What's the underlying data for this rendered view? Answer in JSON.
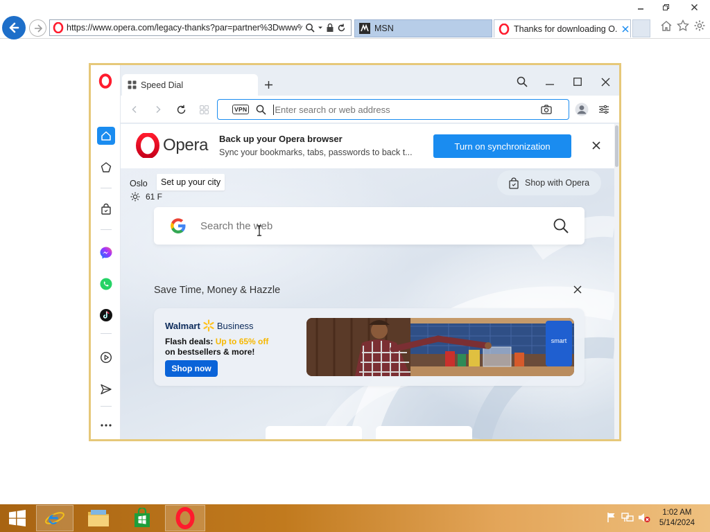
{
  "ie": {
    "url": "https://www.opera.com/legacy-thanks?par=partner%3Dwww%2",
    "tabs": [
      {
        "label": "MSN",
        "active": false
      },
      {
        "label": "Thanks for downloading O...",
        "active": true
      }
    ]
  },
  "opera": {
    "tab": {
      "label": "Speed Dial"
    },
    "address": {
      "vpn_label": "VPN",
      "placeholder": "Enter search or web address"
    },
    "sync": {
      "logo_text": "Opera",
      "title": "Back up your Opera browser",
      "desc": "Sync your bookmarks, tabs, passwords to back t...",
      "button": "Turn on synchronization"
    },
    "weather": {
      "city": "Oslo",
      "tooltip": "Set up your city",
      "temp": "61 F"
    },
    "shop": {
      "label": "Shop with Opera"
    },
    "search": {
      "placeholder": "Search the web"
    },
    "promo": {
      "section_title": "Save Time, Money & Hazzle",
      "brand": "Walmart",
      "brand_suffix": "Business",
      "deal_line1": "Flash deals: ",
      "deal_highlight": "Up to 65% off",
      "deal_line2": "on bestsellers & more!",
      "cta": "Shop now",
      "image_badge": "smart"
    }
  },
  "taskbar": {
    "time": "1:02 AM",
    "date": "5/14/2024"
  },
  "colors": {
    "opera_red": "#ff1b2d",
    "opera_blue": "#1a8cf0",
    "walmart_yellow": "#ffc220",
    "frame_gold": "#e6c879"
  }
}
